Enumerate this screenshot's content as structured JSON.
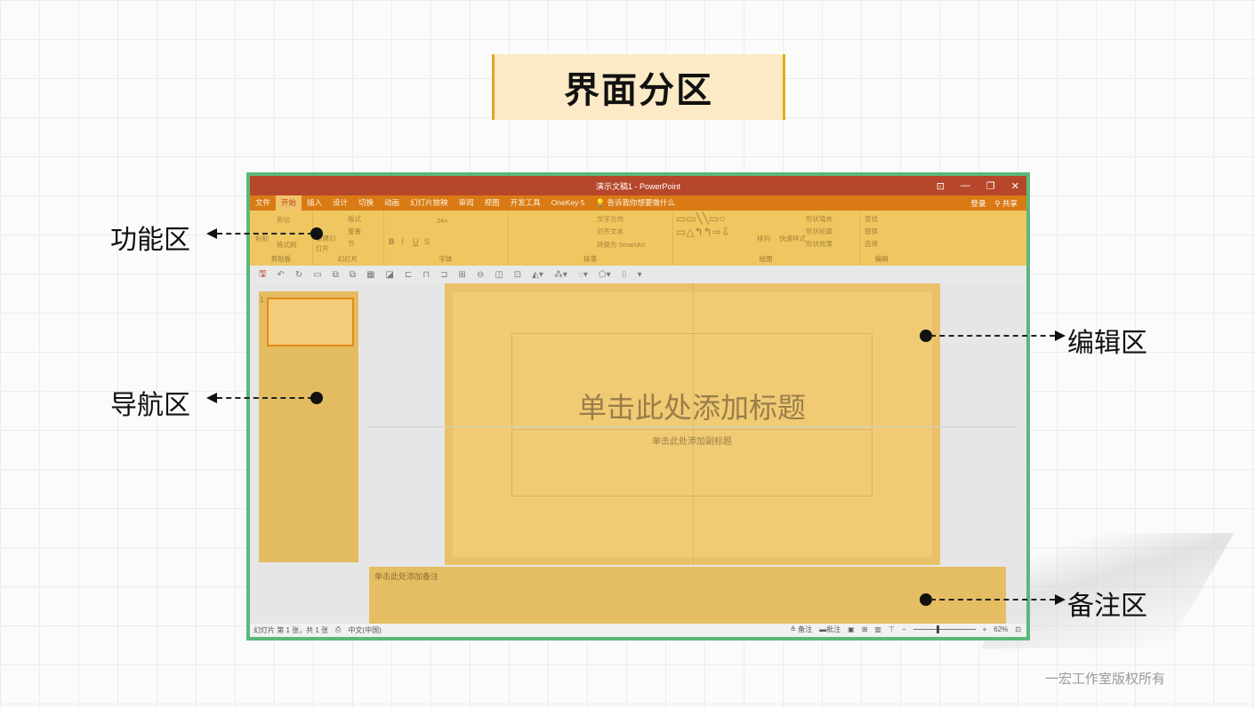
{
  "page_title": "界面分区",
  "window": {
    "title": "演示文稿1 - PowerPoint",
    "controls": [
      "⊡",
      "—",
      "❐",
      "✕"
    ]
  },
  "menu": {
    "tabs": [
      "文件",
      "开始",
      "插入",
      "设计",
      "切换",
      "动画",
      "幻灯片放映",
      "审阅",
      "视图",
      "开发工具",
      "OneKey 5"
    ],
    "active_tab": "开始",
    "tell_me": "告诉我你想要做什么",
    "login": "登录",
    "share": "共享"
  },
  "ribbon": {
    "groups": [
      "剪贴板",
      "幻灯片",
      "字体",
      "段落",
      "绘图",
      "编辑"
    ],
    "clipboard": {
      "paste": "粘贴",
      "cut": "剪切",
      "format_painter": "格式刷"
    },
    "slides": {
      "new_slide": "新建幻灯片",
      "layout": "版式",
      "reset": "重置",
      "section": "节"
    },
    "font": {
      "size": "24+",
      "bold": "B",
      "italic": "I",
      "underline": "U",
      "strike": "S"
    },
    "paragraph": {
      "text_direction": "文字方向",
      "align_text": "对齐文本",
      "smartart": "转换为 SmartArt"
    },
    "drawing": {
      "arrange": "排列",
      "quick_styles": "快速样式",
      "shape_fill": "形状填充",
      "shape_outline": "形状轮廓",
      "shape_effects": "形状效果"
    },
    "editing": {
      "find": "查找",
      "replace": "替换",
      "select": "选择"
    }
  },
  "nav": {
    "slide_number": "1"
  },
  "slide": {
    "title_placeholder": "单击此处添加标题",
    "subtitle_placeholder": "单击此处添加副标题"
  },
  "notes": {
    "placeholder": "单击此处添加备注"
  },
  "status": {
    "slide_info": "幻灯片 第 1 张，共 1 张",
    "language": "中文(中国)",
    "notes_btn": "备注",
    "comments_btn": "批注",
    "zoom": "62%"
  },
  "callouts": {
    "ribbon": "功能区",
    "nav": "导航区",
    "edit": "编辑区",
    "notes": "备注区"
  },
  "copyright": "一宏工作室版权所有",
  "colors": {
    "accent_gold": "#e4a81c",
    "frame_green": "#5cb87a",
    "titlebar_red": "#b7472a",
    "overlay_yellow": "#efc761"
  }
}
